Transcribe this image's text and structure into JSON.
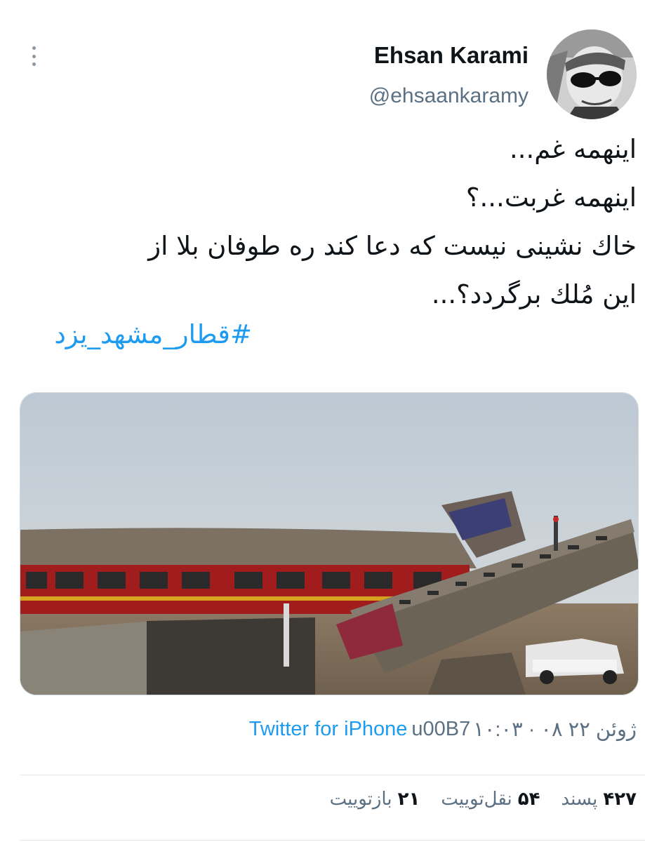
{
  "tweet": {
    "author_name": "Ehsan Karami",
    "author_handle": "@ehsaankaramy",
    "text_lines": [
      "اینهمه غم...",
      "اینهمه غربت...؟",
      "خاك نشینی نیست كه دعا كند ره طوفان بلا از",
      "این مُلك برگردد؟..."
    ],
    "hashtag": "#قطار_مشهد_یزد",
    "timestamp": "۱۰:۰۳ · ۰۸ ژوئن ۲۲",
    "separator": "u00B7",
    "source": "Twitter for iPhone"
  },
  "stats": {
    "retweets": {
      "count": "۲۱",
      "label": "بازتوییت"
    },
    "quotes": {
      "count": "۵۴",
      "label": "نقل‌توییت"
    },
    "likes": {
      "count": "۴۲۷",
      "label": "پسند"
    }
  },
  "icons": {
    "more": "more-vertical-icon"
  },
  "colors": {
    "link": "#1d9bf0",
    "secondary_text": "#5b7083",
    "primary_text": "#0f1419",
    "divider": "#e1e8ed"
  }
}
